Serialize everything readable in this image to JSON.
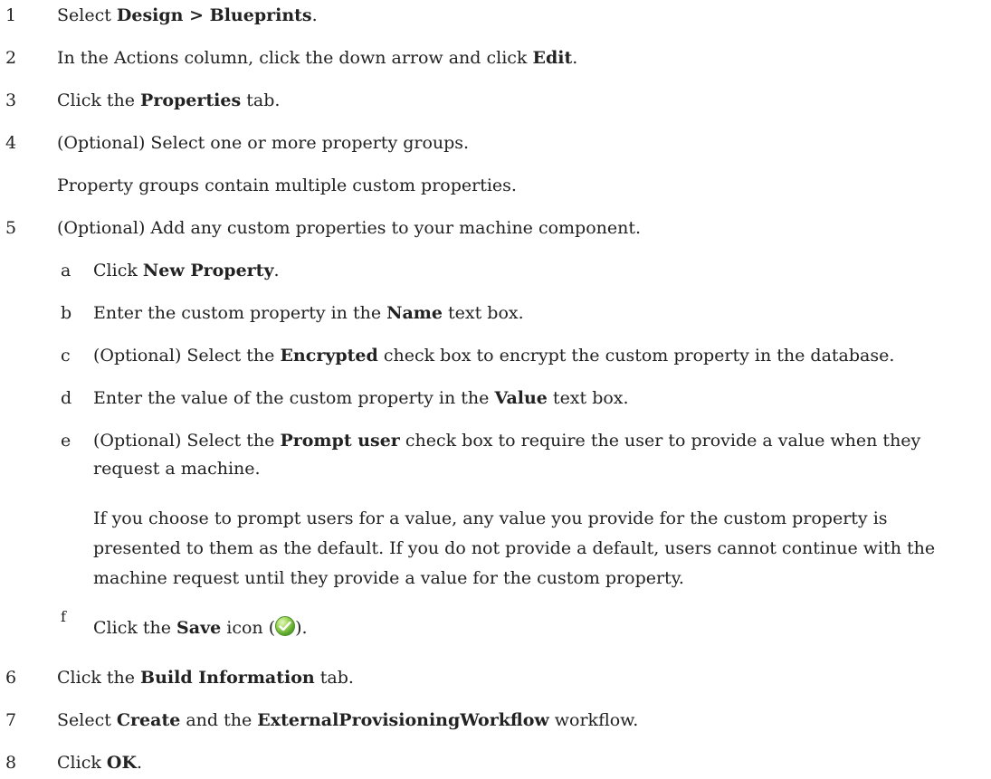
{
  "steps": [
    {
      "num": "1",
      "pre": "Select ",
      "bold": "Design > Blueprints",
      "post": "."
    },
    {
      "num": "2",
      "pre": "In the Actions column, click the down arrow and click ",
      "bold": "Edit",
      "post": "."
    },
    {
      "num": "3",
      "pre": "Click the ",
      "bold": "Properties",
      "post": " tab."
    },
    {
      "num": "4",
      "pre": "(Optional) Select one or more property groups.",
      "bold": "",
      "post": "",
      "note": "Property groups contain multiple custom properties."
    },
    {
      "num": "5",
      "pre": "(Optional) Add any custom properties to your machine component.",
      "bold": "",
      "post": ""
    },
    {
      "num": "6",
      "pre": "Click the ",
      "bold": "Build Information",
      "post": " tab."
    },
    {
      "num": "7",
      "pre": "Select ",
      "bold": "Create",
      "mid": " and the ",
      "bold2": "ExternalProvisioningWorkflow",
      "post": " workflow."
    },
    {
      "num": "8",
      "pre": "Click ",
      "bold": "OK",
      "post": "."
    }
  ],
  "substeps": [
    {
      "letter": "a",
      "pre": "Click ",
      "bold": "New Property",
      "post": "."
    },
    {
      "letter": "b",
      "pre": "Enter the custom property in the ",
      "bold": "Name",
      "post": " text box."
    },
    {
      "letter": "c",
      "pre": "(Optional) Select the ",
      "bold": "Encrypted",
      "post": " check box to encrypt the custom property in the database."
    },
    {
      "letter": "d",
      "pre": "Enter the value of the custom property in the ",
      "bold": "Value",
      "post": " text box."
    },
    {
      "letter": "e",
      "pre": "(Optional) Select the ",
      "bold": "Prompt user",
      "post": " check box to require the user to provide a value when they",
      "cont": "request a machine.",
      "note_lines": [
        "If you choose to prompt users for a value, any value you provide for the custom property is",
        "presented to them as the default. If you do not provide a default, users cannot continue with the",
        "machine request until they provide a value for the custom property."
      ]
    },
    {
      "letter": "f",
      "pre": "Click the ",
      "bold": "Save",
      "post": " icon (",
      "post2": ")."
    }
  ],
  "icons": {
    "save": "save-check-icon",
    "save_color": "#57a52c"
  }
}
